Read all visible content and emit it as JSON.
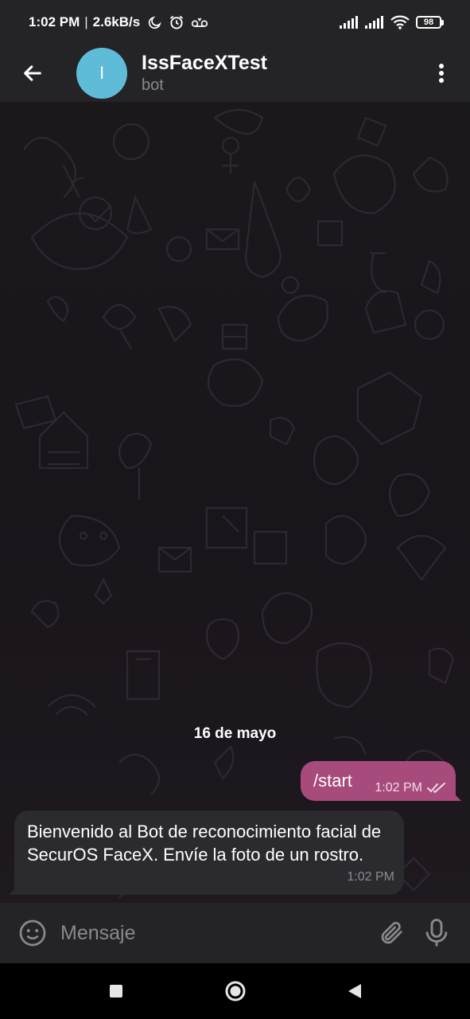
{
  "status_bar": {
    "time": "1:02 PM",
    "network_speed": "2.6kB/s",
    "battery": "98",
    "icons_left": [
      "moon-icon",
      "alarm-icon",
      "voicemail-icon"
    ],
    "icons_right": [
      "signal-icon",
      "signal-icon",
      "wifi-icon",
      "battery-icon"
    ]
  },
  "header": {
    "avatar_letter": "I",
    "avatar_color": "#5fbcd9",
    "title": "IssFaceXTest",
    "subtitle": "bot",
    "back_icon": "arrow-left-icon",
    "menu_icon": "more-vertical-icon"
  },
  "chat": {
    "date_label": "16 de mayo",
    "messages": [
      {
        "direction": "out",
        "text": "/start",
        "time": "1:02 PM",
        "status_icon": "double-check-icon",
        "color": "#a74a7c"
      },
      {
        "direction": "in",
        "text": "Bienvenido al Bot de reconocimiento facial de SecurOS FaceX. Envíe la foto de un rostro.",
        "time": "1:02 PM",
        "color": "#2b2a2e"
      }
    ]
  },
  "composer": {
    "placeholder": "Mensaje",
    "emoji_icon": "smile-icon",
    "attach_icon": "paperclip-icon",
    "mic_icon": "microphone-icon"
  },
  "nav": {
    "icons": [
      "recent-apps-icon",
      "home-icon",
      "back-triangle-icon"
    ]
  }
}
